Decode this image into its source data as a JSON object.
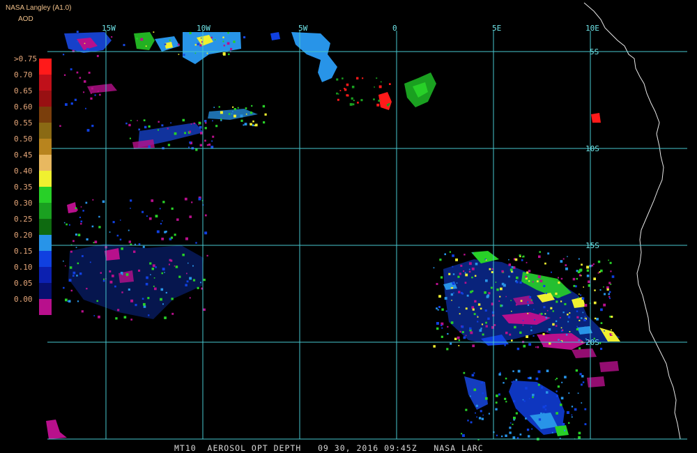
{
  "header": {
    "source": "NASA Langley (A1.0)",
    "product": "AOD"
  },
  "legend": {
    "labels": [
      ">0.75",
      "0.70",
      "0.65",
      "0.60",
      "0.55",
      "0.50",
      "0.45",
      "0.40",
      "0.35",
      "0.30",
      "0.25",
      "0.20",
      "0.15",
      "0.10",
      "0.05",
      "0.00"
    ],
    "colors": [
      "#ff1a1a",
      "#c0101a",
      "#981012",
      "#7a3e0c",
      "#8a6a14",
      "#b8841e",
      "#e8b860",
      "#f0f030",
      "#28d028",
      "#1aa020",
      "#0e6a10",
      "#2894e8",
      "#1040e0",
      "#0c20b0",
      "#081070",
      "#b8108c"
    ]
  },
  "grid": {
    "longitudes": [
      "15W",
      "10W",
      "5W",
      "0",
      "5E",
      "10E"
    ],
    "latitudes": [
      "5S",
      "10S",
      "15S",
      "20S"
    ],
    "line_color": "#48c8d0"
  },
  "footer": {
    "text": "MT10  AEROSOL OPT DEPTH   09 30, 2016 09:45Z   NASA LARC"
  }
}
